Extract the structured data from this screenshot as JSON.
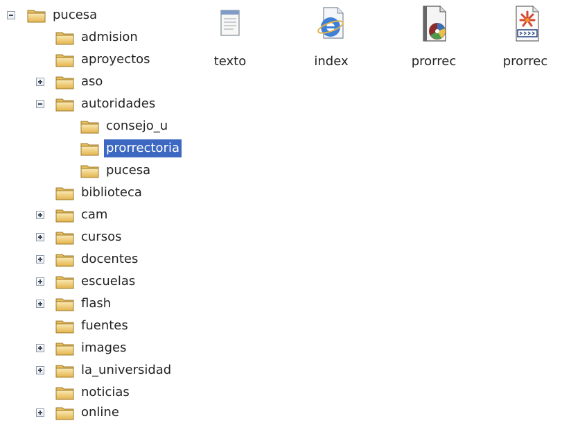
{
  "tree": {
    "root": {
      "label": "pucesa",
      "expander": "minus"
    },
    "items": [
      {
        "label": "admision",
        "expander": "none"
      },
      {
        "label": "aproyectos",
        "expander": "none"
      },
      {
        "label": "aso",
        "expander": "plus"
      },
      {
        "label": "autoridades",
        "expander": "minus"
      },
      {
        "label": "consejo_u",
        "expander": "none"
      },
      {
        "label": "prorrectoria",
        "expander": "none",
        "selected": true
      },
      {
        "label": "pucesa",
        "expander": "none"
      },
      {
        "label": "biblioteca",
        "expander": "none"
      },
      {
        "label": "cam",
        "expander": "plus"
      },
      {
        "label": "cursos",
        "expander": "plus"
      },
      {
        "label": "docentes",
        "expander": "plus"
      },
      {
        "label": "escuelas",
        "expander": "plus"
      },
      {
        "label": "flash",
        "expander": "plus"
      },
      {
        "label": "fuentes",
        "expander": "none"
      },
      {
        "label": "images",
        "expander": "plus"
      },
      {
        "label": "la_universidad",
        "expander": "plus"
      },
      {
        "label": "noticias",
        "expander": "none"
      },
      {
        "label": "online",
        "expander": "plus"
      }
    ]
  },
  "files": [
    {
      "label": "texto",
      "icon": "notepad-icon"
    },
    {
      "label": "index",
      "icon": "html-document-icon"
    },
    {
      "label": "prorrec",
      "icon": "media-file-icon"
    },
    {
      "label": "prorrec",
      "icon": "flash-movie-icon"
    }
  ],
  "colors": {
    "selection": "#3c68c2",
    "folder": "#f2d27a"
  }
}
